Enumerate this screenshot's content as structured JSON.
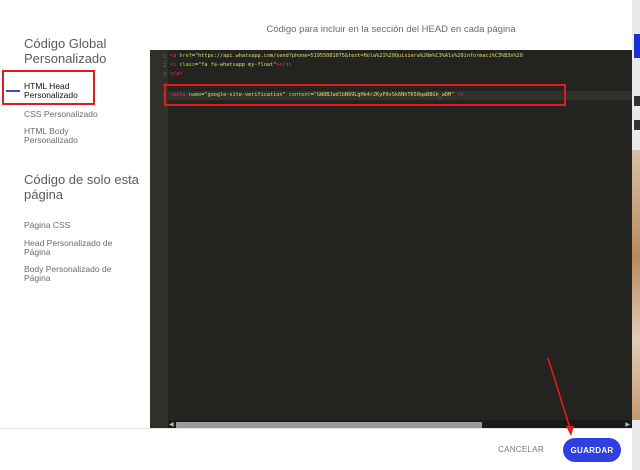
{
  "sidebar": {
    "global_title": "Código Global Personalizado",
    "global_items": [
      {
        "label": "HTML Head Personalizado",
        "active": true
      },
      {
        "label": "CSS Personalizado",
        "active": false
      },
      {
        "label": "HTML Body Personalizado",
        "active": false
      }
    ],
    "page_title": "Código de solo esta página",
    "page_items": [
      {
        "label": "Página CSS"
      },
      {
        "label": "Head Personalizado de Página"
      },
      {
        "label": "Body Personalizado de Página"
      }
    ]
  },
  "editor": {
    "caption": "Código para incluir en la sección del HEAD en cada página",
    "line_numbers": [
      "1",
      "2",
      "3",
      "4",
      "5"
    ],
    "lines": [
      {
        "open": "<a ",
        "attr": "href",
        "eq": "=",
        "value": "\"https://api.whatsapp.com/send?phone=51955081075&text=Hola%21%20Quisiera%20m%C3%A1s%20informaci%C3%B3n%20",
        "close": ""
      },
      {
        "open": "<i ",
        "attr": "class",
        "eq": "=",
        "value": "\"fa fa-whatsapp my-float\"",
        "close": "></i>"
      },
      {
        "open": "</a>",
        "attr": "",
        "eq": "",
        "value": "",
        "close": ""
      },
      {
        "open": "",
        "attr": "",
        "eq": "",
        "value": "",
        "close": ""
      },
      {
        "open": "<meta ",
        "attr": "name",
        "eq": "=",
        "value": "\"google-site-verification\"",
        "attr2": " content",
        "value2": "\"GW8BJadlbN99LgHk4r2KyP9vSk6NhTK50qaB8Gh_wDM\"",
        "close": " />"
      }
    ]
  },
  "footer": {
    "cancel_label": "CANCELAR",
    "save_label": "GUARDAR"
  },
  "colors": {
    "accent": "#2f3fe0",
    "annotation": "#e01c1c",
    "editor_bg": "#23241f"
  }
}
